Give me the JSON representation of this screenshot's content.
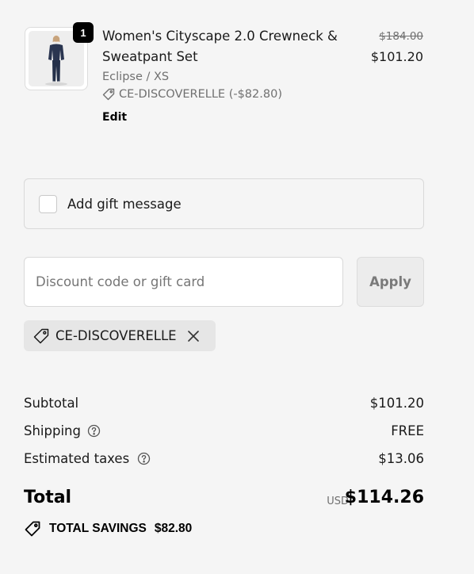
{
  "line_item": {
    "quantity": "1",
    "title": "Women's Cityscape 2.0 Crewneck & Sweatpant Set",
    "variant": "Eclipse / XS",
    "discount_applied": "CE-DISCOVERELLE (-$82.80)",
    "edit_label": "Edit",
    "original_price": "$184.00",
    "price": "$101.20",
    "image_icon": "product-image-woman-navy-sweat-set"
  },
  "gift": {
    "label": "Add gift message",
    "checked": false
  },
  "discount": {
    "placeholder": "Discount code or gift card",
    "value": "",
    "apply_label": "Apply",
    "applied_code": "CE-DISCOVERELLE"
  },
  "summary": {
    "subtotal_label": "Subtotal",
    "subtotal_value": "$101.20",
    "shipping_label": "Shipping",
    "shipping_value": "FREE",
    "taxes_label": "Estimated taxes",
    "taxes_value": "$13.06",
    "total_label": "Total",
    "currency": "USD",
    "total_value": "$114.26",
    "savings_label": "TOTAL SAVINGS",
    "savings_value": "$82.80"
  },
  "colors": {
    "background": "#f5f5f5",
    "text": "#1a1a1a",
    "muted": "#707070",
    "badge": "#000000"
  }
}
